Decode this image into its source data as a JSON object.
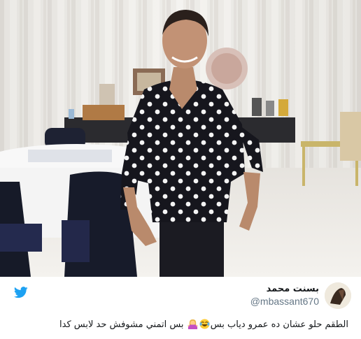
{
  "tweet": {
    "display_name": "بسنت محمد",
    "handle": "@mbassant670",
    "text_part1": "الطقم حلو عشان ده عمرو دياب بس",
    "text_part2": "بس اتمني مشوفش حد لابس كدا",
    "emoji_1": "face-with-tears-of-joy",
    "emoji_2": "woman-shrugging"
  },
  "icons": {
    "platform": "twitter-bird-icon"
  },
  "colors": {
    "twitter_blue": "#1da1f2",
    "name": "#14171a",
    "handle": "#657786"
  }
}
